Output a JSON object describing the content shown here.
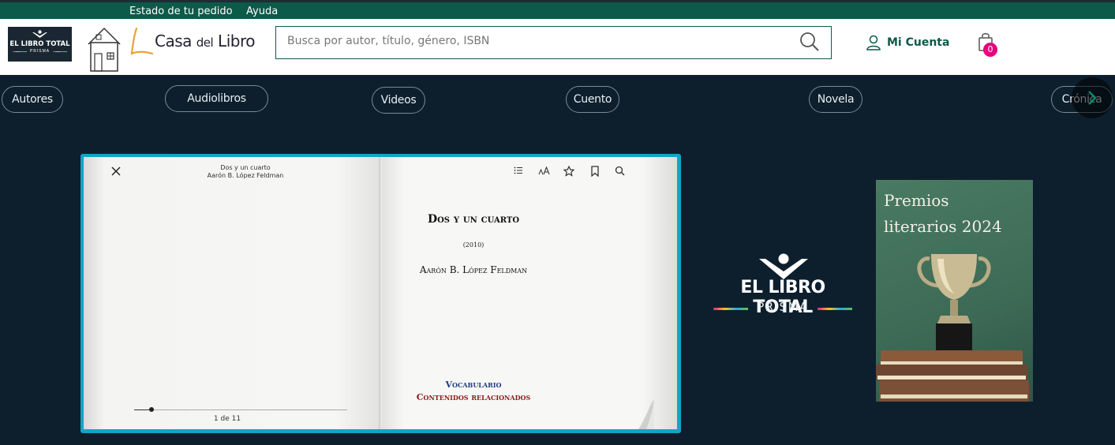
{
  "topbar": {
    "order_status": "Estado de tu pedido",
    "help": "Ayuda"
  },
  "header": {
    "partner_logo": {
      "line1": "EL LIBRO TOTAL",
      "line2": "PRISMA"
    },
    "brand": {
      "name_part1": "Casa ",
      "name_part2": "del",
      "name_part3": " Libro"
    },
    "search": {
      "placeholder": "Busca por autor, título, género, ISBN",
      "value": ""
    },
    "account_label": "Mi Cuenta",
    "cart_count": "0"
  },
  "categories": [
    "Autores",
    "Audiolibros",
    "Videos",
    "Cuento",
    "Novela",
    "Crónica"
  ],
  "reader": {
    "header_title": "Dos y un cuarto",
    "header_author": "Aarón B. López Feldman",
    "book_title": "Dos y un cuarto",
    "year": "(2010)",
    "author": "Aarón B. López Feldman",
    "vocabulary_link": "Vocabulario",
    "related_link": "Contenidos relacionados",
    "page_indicator": "1 de 11",
    "progress": 0.08
  },
  "side_logo": {
    "line1": "EL LIBRO TOTAL",
    "line2": "PRISMA"
  },
  "promo": {
    "title": "Premios literarios 2024"
  },
  "colors": {
    "topbar": "#0c5a4a",
    "page_bg": "#0d1f2d",
    "accent": "#0c5a4a",
    "badge": "#e6007e",
    "book_frame": "#12a5c4"
  },
  "icons": [
    "search-icon",
    "user-icon",
    "bag-icon",
    "close-icon",
    "toc-icon",
    "font-size-icon",
    "star-icon",
    "bookmark-icon",
    "chevron-right-icon"
  ]
}
